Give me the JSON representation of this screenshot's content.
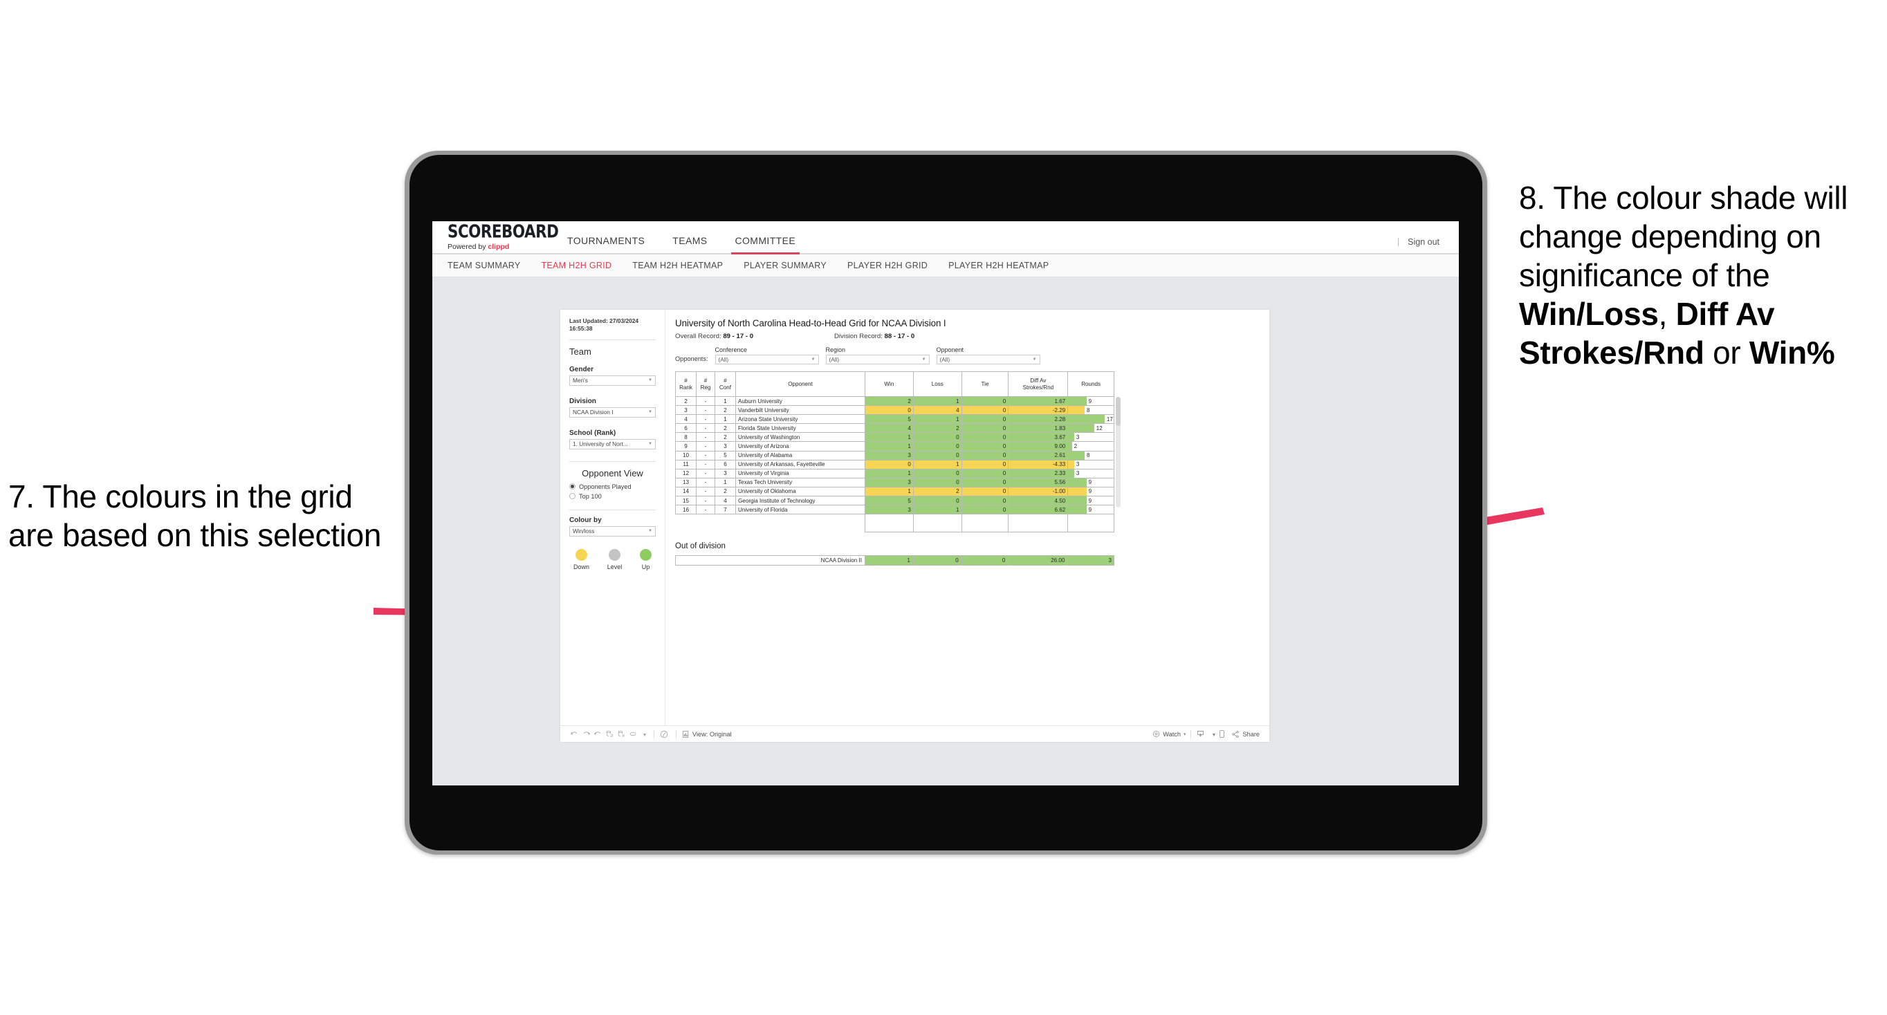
{
  "annotations": {
    "left": "7. The colours in the grid are based on this selection",
    "right_pre": "8. The colour shade will change depending on significance of the ",
    "right_b1": "Win/Loss",
    "right_mid1": ", ",
    "right_b2": "Diff Av Strokes/Rnd",
    "right_mid2": " or ",
    "right_b3": "Win%",
    "arrow_color": "#e8365f"
  },
  "app": {
    "logo": {
      "main": "SCOREBOARD",
      "powered": "Powered by ",
      "brand": "clippd"
    },
    "top_nav": [
      {
        "label": "TOURNAMENTS",
        "active": false
      },
      {
        "label": "TEAMS",
        "active": false
      },
      {
        "label": "COMMITTEE",
        "active": true
      }
    ],
    "sign_out": "Sign out",
    "sign_out_sep": "|",
    "sub_nav": [
      {
        "label": "TEAM SUMMARY",
        "active": false
      },
      {
        "label": "TEAM H2H GRID",
        "active": true
      },
      {
        "label": "TEAM H2H HEATMAP",
        "active": false
      },
      {
        "label": "PLAYER SUMMARY",
        "active": false
      },
      {
        "label": "PLAYER H2H GRID",
        "active": false
      },
      {
        "label": "PLAYER H2H HEATMAP",
        "active": false
      }
    ]
  },
  "panel": {
    "last_updated": "Last Updated: 27/03/2024 16:55:38",
    "team_heading": "Team",
    "gender": {
      "label": "Gender",
      "value": "Men's"
    },
    "division": {
      "label": "Division",
      "value": "NCAA Division I"
    },
    "school": {
      "label": "School (Rank)",
      "value": "1. University of Nort..."
    },
    "opponent_view": {
      "heading": "Opponent View",
      "options": [
        {
          "label": "Opponents Played",
          "selected": true
        },
        {
          "label": "Top 100",
          "selected": false
        }
      ]
    },
    "colour_by": {
      "label": "Colour by",
      "value": "Win/loss"
    },
    "legend": [
      {
        "caption": "Down",
        "color": "#f6d552"
      },
      {
        "caption": "Level",
        "color": "#c4c4c4"
      },
      {
        "caption": "Up",
        "color": "#8fcc5f"
      }
    ]
  },
  "viz": {
    "title": "University of North Carolina Head-to-Head Grid for NCAA Division I",
    "overall_record_label": "Overall Record: ",
    "overall_record": "89 - 17 - 0",
    "division_record_label": "Division Record: ",
    "division_record": "88 - 17 - 0",
    "opponents_lead": "Opponents:",
    "filters": [
      {
        "caption": "Conference",
        "value": "(All)"
      },
      {
        "caption": "Region",
        "value": "(All)"
      },
      {
        "caption": "Opponent",
        "value": "(All)"
      }
    ],
    "columns": [
      "# Rank",
      "# Reg",
      "# Conf",
      "Opponent",
      "Win",
      "Loss",
      "Tie",
      "Diff Av Strokes/Rnd",
      "Rounds"
    ],
    "rows": [
      {
        "rank": "2",
        "reg": "-",
        "conf": "1",
        "opponent": "Auburn University",
        "win": "2",
        "loss": "1",
        "tie": "0",
        "diff": "1.67",
        "rounds": "9",
        "shade": "g",
        "bar_pct": 40
      },
      {
        "rank": "3",
        "reg": "-",
        "conf": "2",
        "opponent": "Vanderbilt University",
        "win": "0",
        "loss": "4",
        "tie": "0",
        "diff": "-2.29",
        "rounds": "8",
        "shade": "y",
        "bar_pct": 36
      },
      {
        "rank": "4",
        "reg": "-",
        "conf": "1",
        "opponent": "Arizona State University",
        "win": "5",
        "loss": "1",
        "tie": "0",
        "diff": "2.28",
        "rounds": "17",
        "shade": "g",
        "bar_pct": 80
      },
      {
        "rank": "6",
        "reg": "-",
        "conf": "2",
        "opponent": "Florida State University",
        "win": "4",
        "loss": "2",
        "tie": "0",
        "diff": "1.83",
        "rounds": "12",
        "shade": "g",
        "bar_pct": 57
      },
      {
        "rank": "8",
        "reg": "-",
        "conf": "2",
        "opponent": "University of Washington",
        "win": "1",
        "loss": "0",
        "tie": "0",
        "diff": "3.67",
        "rounds": "3",
        "shade": "g",
        "bar_pct": 13
      },
      {
        "rank": "9",
        "reg": "-",
        "conf": "3",
        "opponent": "University of Arizona",
        "win": "1",
        "loss": "0",
        "tie": "0",
        "diff": "9.00",
        "rounds": "2",
        "shade": "g",
        "bar_pct": 8
      },
      {
        "rank": "10",
        "reg": "-",
        "conf": "5",
        "opponent": "University of Alabama",
        "win": "3",
        "loss": "0",
        "tie": "0",
        "diff": "2.61",
        "rounds": "8",
        "shade": "g",
        "bar_pct": 36
      },
      {
        "rank": "11",
        "reg": "-",
        "conf": "6",
        "opponent": "University of Arkansas, Fayetteville",
        "win": "0",
        "loss": "1",
        "tie": "0",
        "diff": "-4.33",
        "rounds": "3",
        "shade": "y",
        "bar_pct": 13
      },
      {
        "rank": "12",
        "reg": "-",
        "conf": "3",
        "opponent": "University of Virginia",
        "win": "1",
        "loss": "0",
        "tie": "0",
        "diff": "2.33",
        "rounds": "3",
        "shade": "g",
        "bar_pct": 13
      },
      {
        "rank": "13",
        "reg": "-",
        "conf": "1",
        "opponent": "Texas Tech University",
        "win": "3",
        "loss": "0",
        "tie": "0",
        "diff": "5.56",
        "rounds": "9",
        "shade": "g",
        "bar_pct": 40
      },
      {
        "rank": "14",
        "reg": "-",
        "conf": "2",
        "opponent": "University of Oklahoma",
        "win": "1",
        "loss": "2",
        "tie": "0",
        "diff": "-1.00",
        "rounds": "9",
        "shade": "y",
        "bar_pct": 40
      },
      {
        "rank": "15",
        "reg": "-",
        "conf": "4",
        "opponent": "Georgia Institute of Technology",
        "win": "5",
        "loss": "0",
        "tie": "0",
        "diff": "4.50",
        "rounds": "9",
        "shade": "g",
        "bar_pct": 40
      },
      {
        "rank": "16",
        "reg": "-",
        "conf": "7",
        "opponent": "University of Florida",
        "win": "3",
        "loss": "1",
        "tie": "0",
        "diff": "6.62",
        "rounds": "9",
        "shade": "g",
        "bar_pct": 40
      }
    ],
    "out_of_division": {
      "title": "Out of division",
      "row": {
        "opponent": "NCAA Division II",
        "win": "1",
        "loss": "0",
        "tie": "0",
        "diff": "26.00",
        "rounds": "3",
        "shade": "g",
        "bar_pct": 100
      }
    }
  },
  "toolbar": {
    "view_label": "View: Original",
    "watch_label": "Watch",
    "share_label": "Share",
    "caret": "▾"
  },
  "chart_data": {
    "type": "table",
    "title": "University of North Carolina Head-to-Head Grid for NCAA Division I",
    "categories": [
      "Auburn University",
      "Vanderbilt University",
      "Arizona State University",
      "Florida State University",
      "University of Washington",
      "University of Arizona",
      "University of Alabama",
      "University of Arkansas, Fayetteville",
      "University of Virginia",
      "Texas Tech University",
      "University of Oklahoma",
      "Georgia Institute of Technology",
      "University of Florida",
      "NCAA Division II"
    ],
    "series": [
      {
        "name": "Win",
        "values": [
          2,
          0,
          5,
          4,
          1,
          1,
          3,
          0,
          1,
          3,
          1,
          5,
          3,
          1
        ]
      },
      {
        "name": "Loss",
        "values": [
          1,
          4,
          1,
          2,
          0,
          0,
          0,
          1,
          0,
          0,
          2,
          0,
          1,
          0
        ]
      },
      {
        "name": "Tie",
        "values": [
          0,
          0,
          0,
          0,
          0,
          0,
          0,
          0,
          0,
          0,
          0,
          0,
          0,
          0
        ]
      },
      {
        "name": "Diff Av Strokes/Rnd",
        "values": [
          1.67,
          -2.29,
          2.28,
          1.83,
          3.67,
          9.0,
          2.61,
          -4.33,
          2.33,
          5.56,
          -1.0,
          4.5,
          6.62,
          26.0
        ]
      },
      {
        "name": "Rounds",
        "values": [
          9,
          8,
          17,
          12,
          3,
          2,
          8,
          3,
          3,
          9,
          9,
          9,
          9,
          3
        ]
      }
    ],
    "colors": {
      "up": "#8fcc5f",
      "down": "#f6d552",
      "level": "#c4c4c4"
    },
    "xlabel": "Opponent",
    "ylabel": "",
    "legend_position": "sidebar"
  }
}
